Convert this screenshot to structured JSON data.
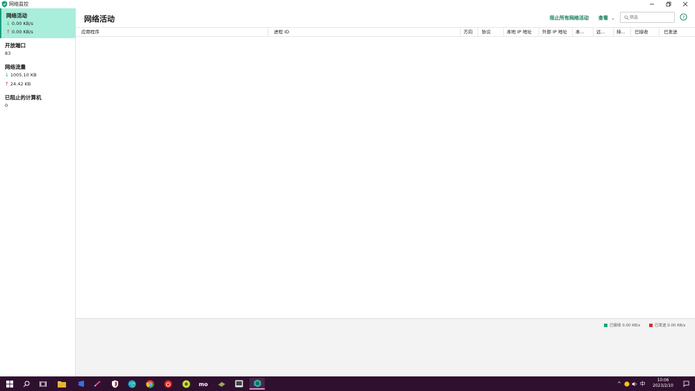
{
  "window": {
    "title": "网络监控",
    "icon": "shield-icon",
    "controls": [
      "minimize-icon",
      "restore-icon",
      "close-icon"
    ]
  },
  "sidebar": {
    "network_activity": {
      "title": "网络活动",
      "download": "0.00 KB/s",
      "upload": "0.00 KB/s"
    },
    "open_ports": {
      "title": "开放端口",
      "value": "83"
    },
    "network_usage": {
      "title": "网络流量",
      "download": "1005.10 KB",
      "upload": "24.42 KB"
    },
    "blocked_apps": {
      "title": "已阻止的计算机",
      "value": "0"
    }
  },
  "header": {
    "title": "网络活动",
    "block_all": "阻止所有网络活动",
    "view": "查看",
    "search_placeholder": "筛选"
  },
  "table": {
    "columns": [
      "应用程序",
      "进程 ID",
      "方向",
      "协议",
      "本地 IP 地址",
      "外部 IP 地址",
      "本...",
      "远...",
      "持...",
      "已接收",
      "已发送"
    ],
    "rows": []
  },
  "legend": {
    "received": "已接收 0.00 KB/s",
    "received_color": "#1aa37a",
    "sent": "已发送 0.00 KB/s",
    "sent_color": "#d13438"
  },
  "taskbar": {
    "apps": [
      "windows-start-icon",
      "search-icon",
      "task-view-icon",
      "file-explorer-icon",
      "visual-studio-icon",
      "pen-app-icon",
      "shield-app-icon",
      "edge-icon",
      "chrome-icon",
      "netease-music-icon",
      "browser-icon",
      "ime-app-icon",
      "tool-icon",
      "media-icon",
      "network-monitor-icon"
    ],
    "tray_lang": "中",
    "time": "10:06",
    "date": "2023/2/10"
  },
  "colors": {
    "accent": "#1a9e7a",
    "active_bg": "#a8eedb",
    "taskbar_bg": "#30102f"
  }
}
